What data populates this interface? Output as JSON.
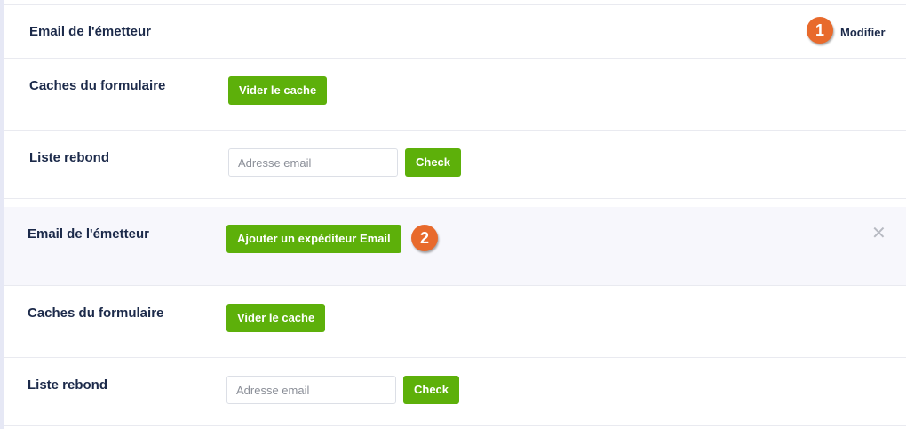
{
  "top_panel": {
    "sender_row": {
      "label": "Email de l'émetteur",
      "badge": "1",
      "action_label": "Modifier"
    },
    "cache_row": {
      "label": "Caches du formulaire",
      "button_label": "Vider le cache"
    },
    "bounce_row": {
      "label": "Liste rebond",
      "email_placeholder": "Adresse email",
      "check_label": "Check"
    }
  },
  "bottom_panel": {
    "sender_row": {
      "label": "Email de l'émetteur",
      "button_label": "Ajouter un expéditeur Email",
      "badge": "2",
      "close_icon": "close-icon"
    },
    "cache_row": {
      "label": "Caches du formulaire",
      "button_label": "Vider le cache"
    },
    "bounce_row": {
      "label": "Liste rebond",
      "email_placeholder": "Adresse email",
      "check_label": "Check"
    }
  },
  "colors": {
    "accent_green": "#5db00a",
    "badge_orange": "#e86a2c",
    "label_navy": "#1c2a4a",
    "highlight_bg": "#f7f7fc"
  }
}
